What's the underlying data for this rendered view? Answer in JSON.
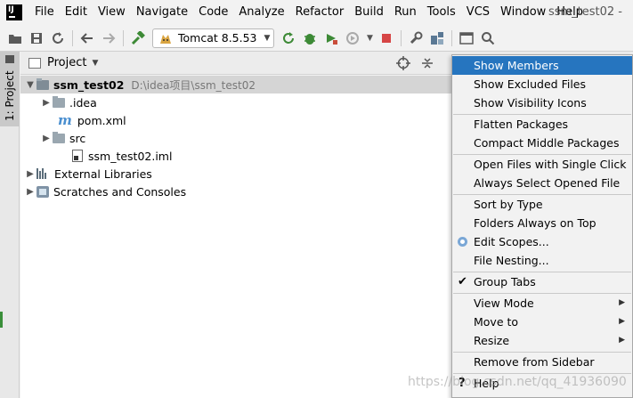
{
  "menubar": {
    "items": [
      "File",
      "Edit",
      "View",
      "Navigate",
      "Code",
      "Analyze",
      "Refactor",
      "Build",
      "Run",
      "Tools",
      "VCS",
      "Window",
      "Help"
    ],
    "window_title": "ssm_test02 -"
  },
  "toolbar": {
    "run_config": "Tomcat 8.5.53"
  },
  "left_stripe": {
    "tab_label": "1: Project"
  },
  "panel": {
    "title": "Project"
  },
  "tree": {
    "root_name": "ssm_test02",
    "root_path": "D:\\idea项目\\ssm_test02",
    "items": [
      {
        "label": ".idea"
      },
      {
        "label": "pom.xml"
      },
      {
        "label": "src"
      },
      {
        "label": "ssm_test02.iml"
      },
      {
        "label": "External Libraries"
      },
      {
        "label": "Scratches and Consoles"
      }
    ]
  },
  "context_menu": {
    "items": [
      "Show Members",
      "Show Excluded Files",
      "Show Visibility Icons",
      "Flatten Packages",
      "Compact Middle Packages",
      "Open Files with Single Click",
      "Always Select Opened File",
      "Sort by Type",
      "Folders Always on Top",
      "Edit Scopes...",
      "File Nesting...",
      "Group Tabs",
      "View Mode",
      "Move to",
      "Resize",
      "Remove from Sidebar",
      "Help"
    ]
  },
  "watermark": "https://blog.csdn.net/qq_41936090"
}
